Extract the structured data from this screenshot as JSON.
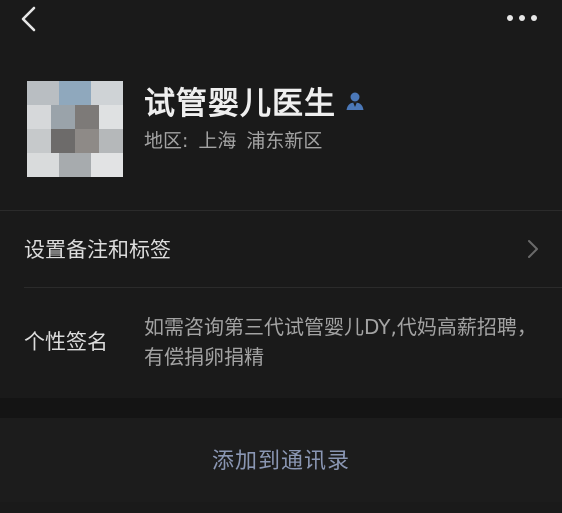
{
  "header": {
    "back_icon": "chevron-left-icon",
    "more_icon": "more-dots-icon"
  },
  "profile": {
    "name": "试管婴儿医生",
    "region_label": "地区:",
    "region_city": "上海",
    "region_district": "浦东新区",
    "verified_icon": "user-badge-icon",
    "accent_color": "#4b78b8"
  },
  "settings": {
    "remark_label": "设置备注和标签",
    "remark_icon": "chevron-right-icon"
  },
  "signature": {
    "label": "个性签名",
    "value": "如需咨询第三代试管婴儿DY,代妈高薪招聘，有偿捐卵捐精"
  },
  "actions": {
    "add_contact_label": "添加到通讯录",
    "link_color": "#8a96b3"
  }
}
